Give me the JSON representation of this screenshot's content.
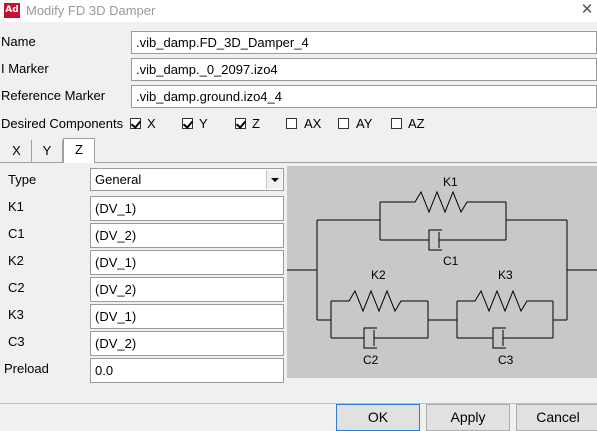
{
  "window": {
    "title": "Modify FD 3D Damper",
    "app_icon": "Ad"
  },
  "fields": [
    {
      "label": "Name",
      "value": ".vib_damp.FD_3D_Damper_4"
    },
    {
      "label": "I Marker",
      "value": ".vib_damp._0_2097.izo4"
    },
    {
      "label": "Reference Marker",
      "value": ".vib_damp.ground.izo4_4"
    }
  ],
  "components": {
    "label": "Desired Components",
    "items": [
      {
        "label": "X",
        "checked": true
      },
      {
        "label": "Y",
        "checked": true
      },
      {
        "label": "Z",
        "checked": true
      },
      {
        "label": "AX",
        "checked": false
      },
      {
        "label": "AY",
        "checked": false
      },
      {
        "label": "AZ",
        "checked": false
      }
    ]
  },
  "tabs": {
    "items": [
      "X",
      "Y",
      "Z"
    ],
    "active": "Z"
  },
  "params": {
    "type_label": "Type",
    "type_value": "General",
    "rows": [
      {
        "label": "K1",
        "value": "(DV_1)"
      },
      {
        "label": "C1",
        "value": "(DV_2)"
      },
      {
        "label": "K2",
        "value": "(DV_1)"
      },
      {
        "label": "C2",
        "value": "(DV_2)"
      },
      {
        "label": "K3",
        "value": "(DV_1)"
      },
      {
        "label": "C3",
        "value": "(DV_2)"
      },
      {
        "label": "Preload",
        "value": "0.0"
      }
    ]
  },
  "diagram": {
    "labels": {
      "k1": "K1",
      "c1": "C1",
      "k2": "K2",
      "c2": "C2",
      "k3": "K3",
      "c3": "C3"
    }
  },
  "buttons": {
    "ok": "OK",
    "apply": "Apply",
    "cancel": "Cancel"
  }
}
